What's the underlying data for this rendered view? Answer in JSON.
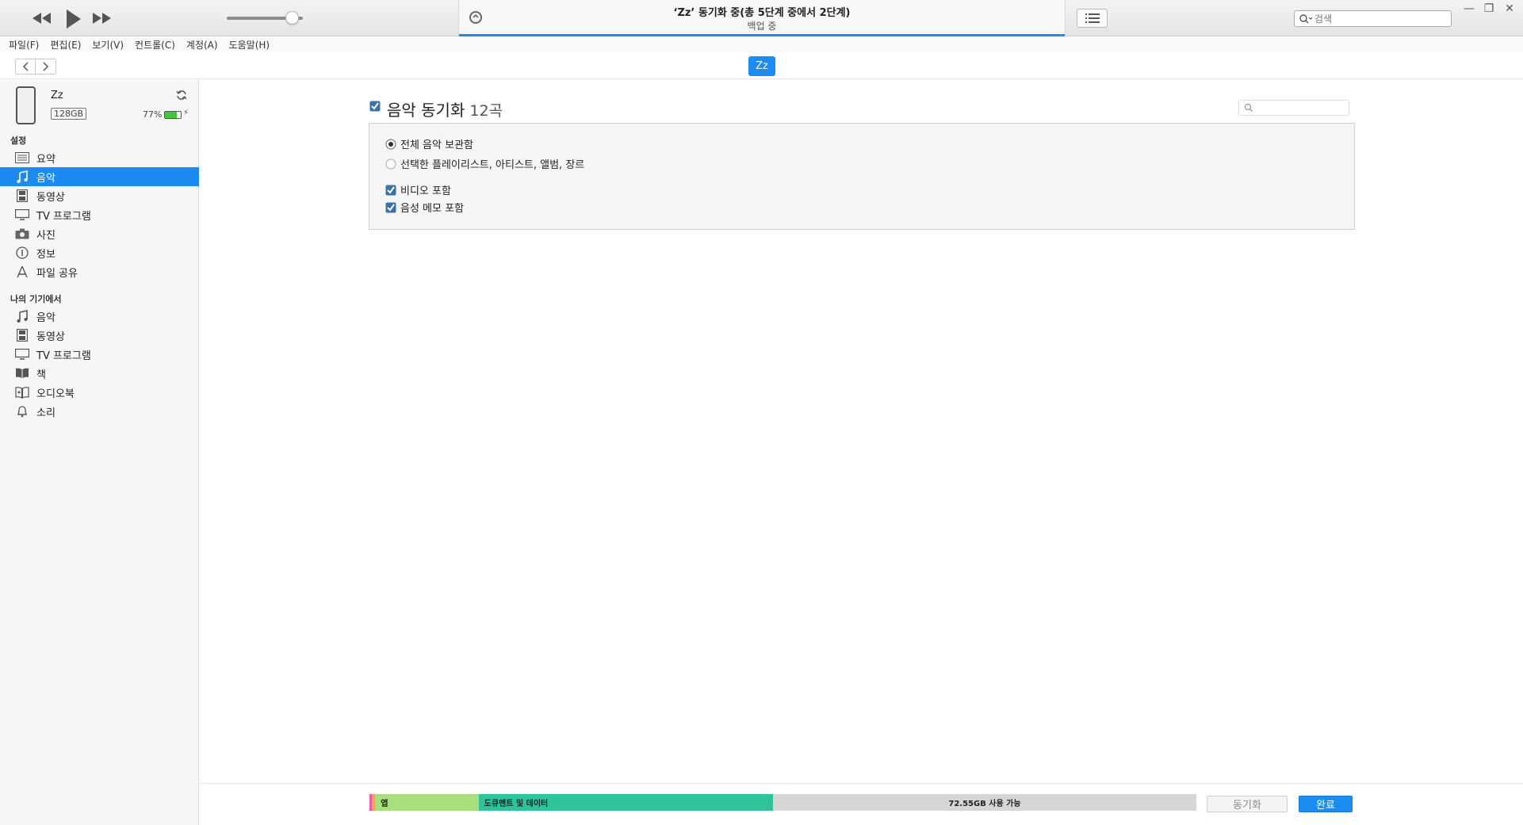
{
  "titlebar": {
    "lcd_title": "‘Zz’ 동기화 중(총 5단계 중에서 2단계)",
    "lcd_subtitle": "백업 중",
    "sync_progress": 1.0,
    "volume_level": 0.85,
    "search_placeholder": "검색",
    "transport_icons": [
      "rewind-icon",
      "play-icon",
      "fast-forward-icon"
    ]
  },
  "menubar": {
    "items": [
      "파일(F)",
      "편집(E)",
      "보기(V)",
      "컨트롤(C)",
      "계정(A)",
      "도움말(H)"
    ]
  },
  "navbar": {
    "device_pill": "Zz"
  },
  "device": {
    "name": "Zz",
    "capacity": "128GB",
    "battery_percent": "77%",
    "battery_level": 0.77,
    "battery_color": "#3ec83e"
  },
  "sidebar": {
    "settings_header": "설정",
    "settings_items": [
      {
        "label": "요약",
        "icon": "summary-icon"
      },
      {
        "label": "음악",
        "icon": "music-icon",
        "active": true
      },
      {
        "label": "동영상",
        "icon": "film-icon"
      },
      {
        "label": "TV 프로그램",
        "icon": "tv-icon"
      },
      {
        "label": "사진",
        "icon": "camera-icon"
      },
      {
        "label": "정보",
        "icon": "info-icon"
      },
      {
        "label": "파일 공유",
        "icon": "app-store-icon"
      }
    ],
    "device_header": "나의 기기에서",
    "device_items": [
      {
        "label": "음악",
        "icon": "music-icon"
      },
      {
        "label": "동영상",
        "icon": "film-icon"
      },
      {
        "label": "TV 프로그램",
        "icon": "tv-icon"
      },
      {
        "label": "책",
        "icon": "book-icon"
      },
      {
        "label": "오디오북",
        "icon": "audiobook-icon"
      },
      {
        "label": "소리",
        "icon": "bell-icon"
      }
    ]
  },
  "main": {
    "sync_title": "음악 동기화",
    "sync_count": "12곡",
    "sync_checked": true,
    "options": {
      "radio_all": "전체 음악 보관함",
      "radio_selected": "선택한 플레이리스트, 아티스트, 앨범, 장르",
      "include_video": "비디오 포함",
      "include_voice_memos": "음성 메모 포함"
    }
  },
  "bottombar": {
    "capacity_segments": [
      {
        "label": "",
        "color": "#e85cab",
        "fraction": 0.003
      },
      {
        "label": "",
        "color": "#f2a15a",
        "fraction": 0.004
      },
      {
        "label": "앱",
        "color": "#a8e07e",
        "fraction": 0.125
      },
      {
        "label": "도큐멘트 및 데이터",
        "color": "#2ec39a",
        "fraction": 0.356
      }
    ],
    "free_label": "72.55GB 사용 가능",
    "sync_button": "동기화",
    "done_button": "완료",
    "accent_color": "#1d8cf0"
  }
}
